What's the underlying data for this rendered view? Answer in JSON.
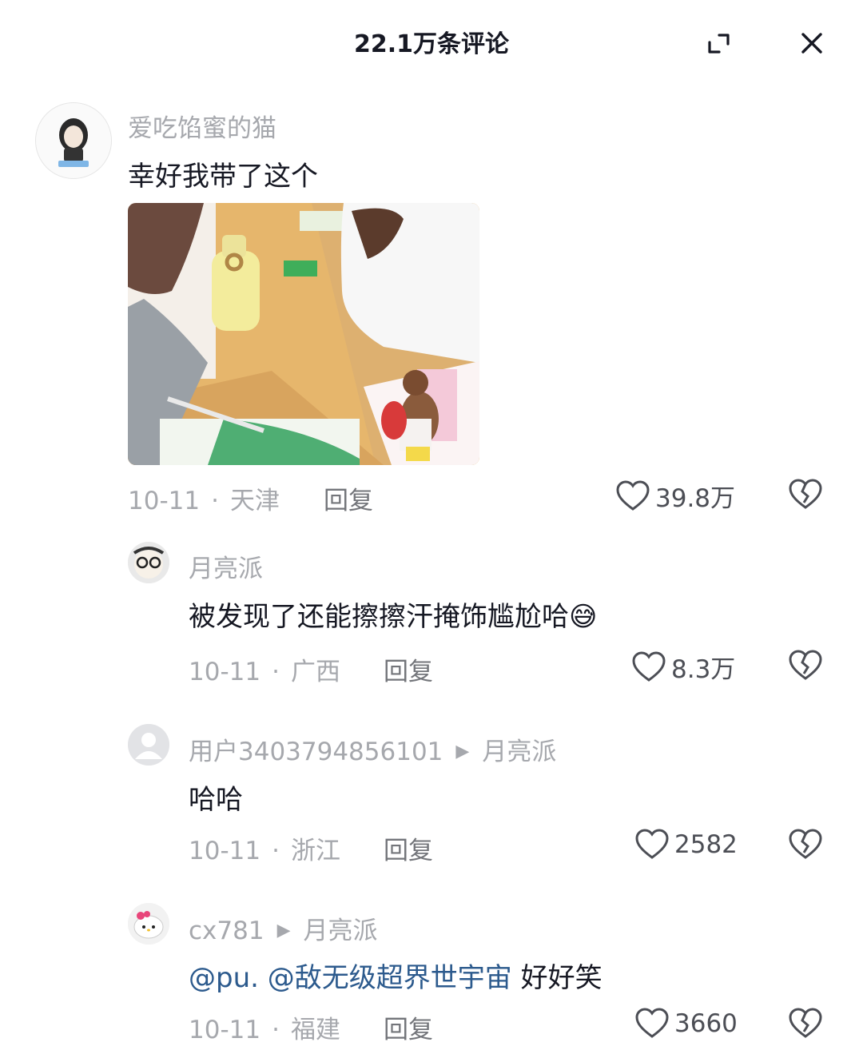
{
  "header": {
    "title": "22.1万条评论",
    "expand_icon": "expand-icon",
    "close_icon": "close-icon"
  },
  "comments": [
    {
      "user": "爱吃馅蜜的猫",
      "text": "幸好我带了这个",
      "date": "10-11",
      "location": "天津",
      "reply_label": "回复",
      "likes": "39.8万",
      "has_image": true
    },
    {
      "user": "月亮派",
      "text": "被发现了还能擦擦汗掩饰尴尬哈",
      "emoji": "😅",
      "date": "10-11",
      "location": "广西",
      "reply_label": "回复",
      "likes": "8.3万"
    },
    {
      "user": "用户3403794856101",
      "reply_to": "月亮派",
      "text": "哈哈",
      "date": "10-11",
      "location": "浙江",
      "reply_label": "回复",
      "likes": "2582"
    },
    {
      "user": "cx781",
      "reply_to": "月亮派",
      "mention1": "@pu.",
      "mention2": "@敌无级超界世宇宙",
      "text": "好好笑",
      "date": "10-11",
      "location": "福建",
      "reply_label": "回复",
      "likes": "3660"
    }
  ],
  "separator": "·",
  "reply_arrow": "▶",
  "colors": {
    "text": "#161823",
    "muted": "#a6a8ad",
    "mention": "#2c5a8d"
  }
}
